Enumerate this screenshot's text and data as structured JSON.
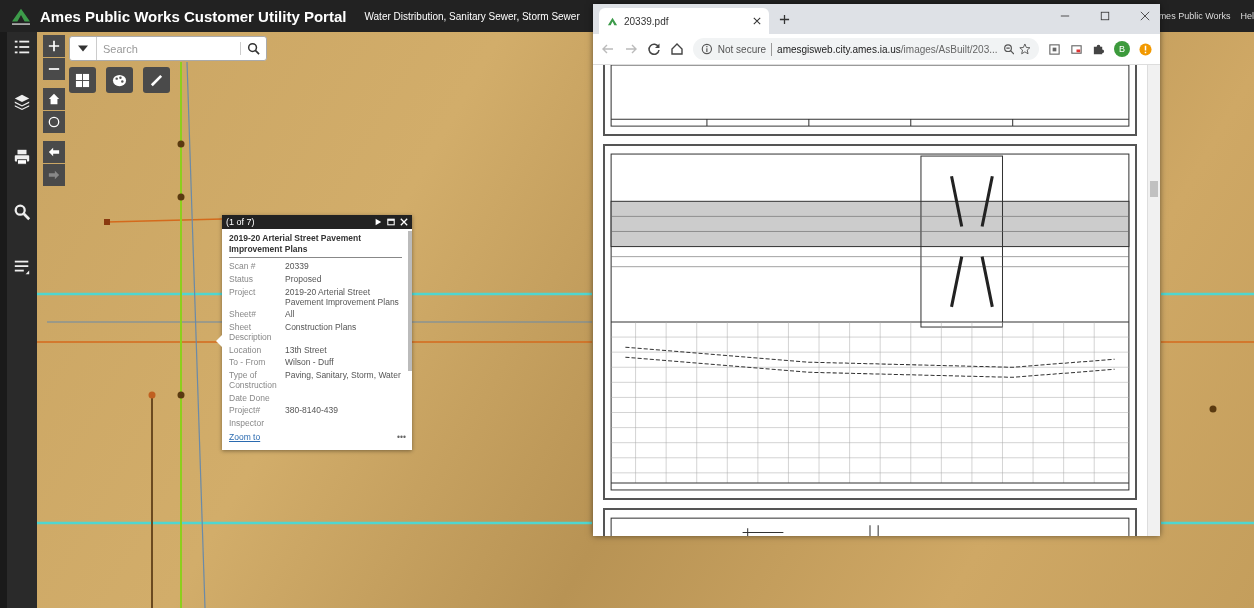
{
  "app": {
    "title": "Ames Public Works Customer Utility Portal",
    "subtitle": "Water Distribution, Sanitary Sewer, Storm Sewer",
    "links": [
      "mes Public Works",
      "Hel"
    ]
  },
  "search": {
    "placeholder": "Search"
  },
  "popup": {
    "counter": "(1 of 7)",
    "title": "2019-20 Arterial Street Pavement Improvement Plans",
    "fields": [
      {
        "label": "Scan #",
        "value": "20339"
      },
      {
        "label": "Status",
        "value": "Proposed"
      },
      {
        "label": "Project",
        "value": "2019-20 Arterial Street Pavement Improvement Plans"
      },
      {
        "label": "Sheet#",
        "value": "All"
      },
      {
        "label": "Sheet Description",
        "value": "Construction Plans"
      },
      {
        "label": "Location",
        "value": "13th Street"
      },
      {
        "label": "To - From",
        "value": "Wilson - Duff"
      },
      {
        "label": "Type of Construction",
        "value": "Paving, Sanitary, Storm, Water"
      },
      {
        "label": "Date Done"
      },
      {
        "label": "Project#",
        "value": "380-8140-439"
      },
      {
        "label": "Inspector"
      }
    ],
    "link": "Zoom to",
    "more": "•••"
  },
  "browser": {
    "tabs": [
      {
        "title": "20339.pdf",
        "selected": true
      }
    ],
    "security": "Not secure",
    "url_host": "amesgisweb.city.ames.ia.us",
    "url_path": "/images/AsBuilt/203...",
    "avatar": "B"
  }
}
